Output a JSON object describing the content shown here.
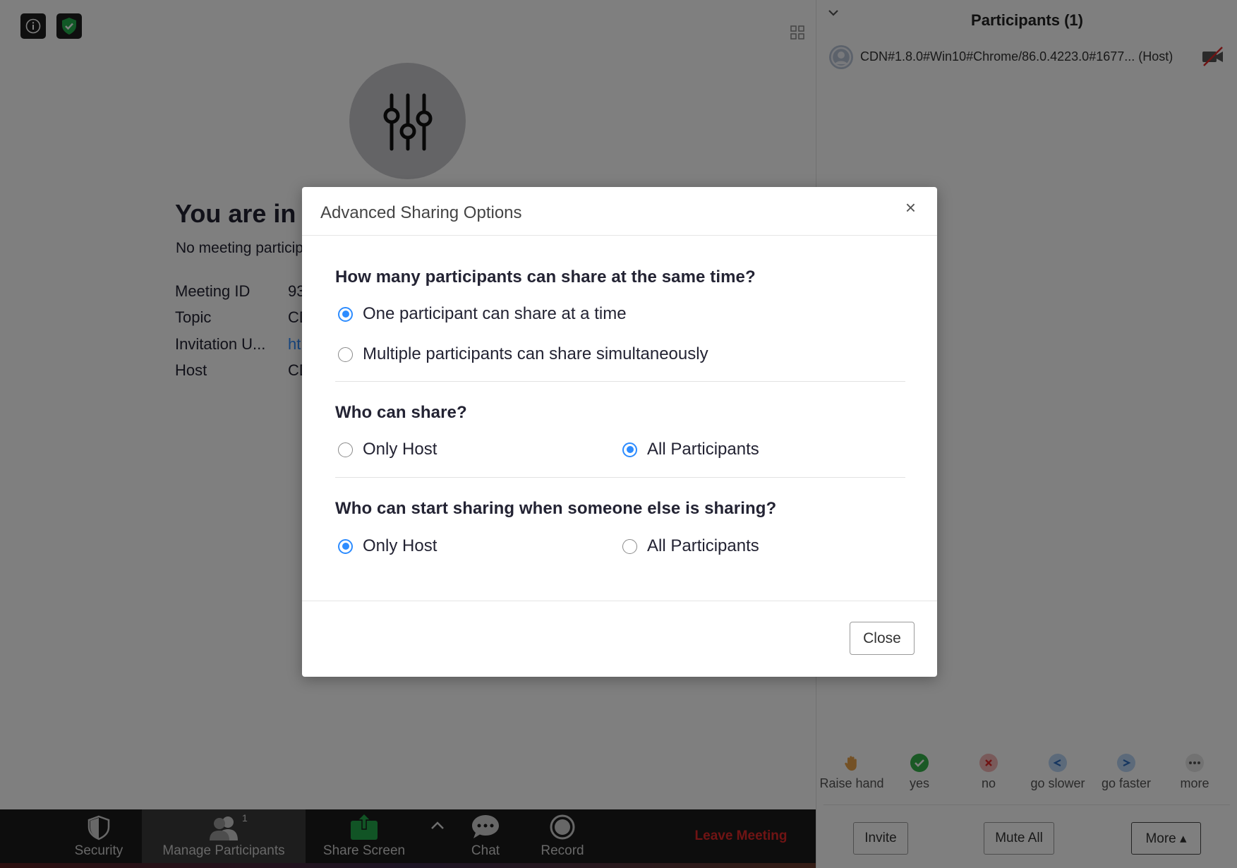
{
  "main": {
    "welcome_title": "You are in the meeting now",
    "welcome_sub": "No meeting participants yet",
    "info": [
      {
        "label": "Meeting ID",
        "value": "93"
      },
      {
        "label": "Topic",
        "value": "CD"
      },
      {
        "label": "Invitation U...",
        "value": "ht"
      },
      {
        "label": "Host",
        "value": "CD"
      }
    ]
  },
  "panel": {
    "title": "Participants (1)",
    "participant": {
      "name": "CDN#1.8.0#Win10#Chrome/86.0.4223.0#1677... (Host)"
    },
    "reactions": [
      {
        "label": "Raise hand",
        "icon": "raise-hand-icon"
      },
      {
        "label": "yes",
        "icon": "check-icon"
      },
      {
        "label": "no",
        "icon": "x-icon"
      },
      {
        "label": "go slower",
        "icon": "go-slower-icon"
      },
      {
        "label": "go faster",
        "icon": "go-faster-icon"
      },
      {
        "label": "more",
        "icon": "more-icon"
      }
    ],
    "buttons": {
      "invite": "Invite",
      "mute_all": "Mute All",
      "more": "More ▴"
    }
  },
  "toolbar": {
    "security": "Security",
    "manage_participants": "Manage Participants",
    "participant_count": "1",
    "share_screen": "Share Screen",
    "chat": "Chat",
    "record": "Record",
    "leave": "Leave Meeting"
  },
  "modal": {
    "title": "Advanced Sharing Options",
    "close_x": "×",
    "q1": {
      "title": "How many participants can share at the same time?",
      "options": [
        {
          "label": "One participant can share at a time",
          "checked": true
        },
        {
          "label": "Multiple participants can share simultaneously",
          "checked": false
        }
      ]
    },
    "q2": {
      "title": "Who can share?",
      "options": [
        {
          "label": "Only Host",
          "checked": false
        },
        {
          "label": "All Participants",
          "checked": true
        }
      ]
    },
    "q3": {
      "title": "Who can start sharing when someone else is sharing?",
      "options": [
        {
          "label": "Only Host",
          "checked": true
        },
        {
          "label": "All Participants",
          "checked": false
        }
      ]
    },
    "close_button": "Close"
  },
  "colors": {
    "accent": "#2d8cff",
    "leave": "#e02828",
    "toolbar_bg": "#1a1a1a",
    "shield_green": "#23b14d",
    "overlay": "rgba(0,0,0,0.5)"
  }
}
